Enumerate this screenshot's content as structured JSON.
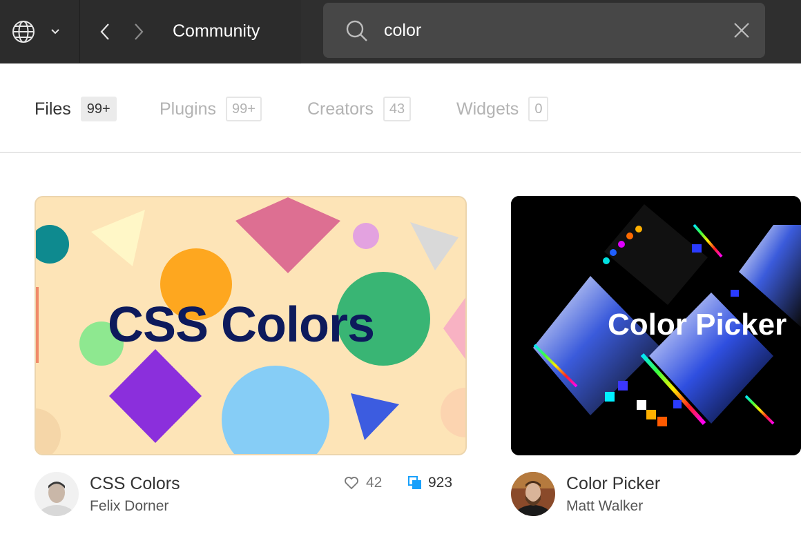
{
  "topbar": {
    "globe_icon": "globe-icon",
    "dropdown_icon": "chevron-down-icon",
    "back_icon": "chevron-left-icon",
    "forward_icon": "chevron-right-icon",
    "breadcrumb": "Community"
  },
  "search": {
    "value": "color",
    "search_icon": "search-icon",
    "clear_icon": "close-icon"
  },
  "tabs": [
    {
      "label": "Files",
      "count": "99+",
      "active": true
    },
    {
      "label": "Plugins",
      "count": "99+",
      "active": false
    },
    {
      "label": "Creators",
      "count": "43",
      "active": false
    },
    {
      "label": "Widgets",
      "count": "0",
      "active": false
    }
  ],
  "cards": [
    {
      "thumbnail_text": "CSS Colors",
      "title": "CSS Colors",
      "author": "Felix Dorner",
      "likes": "42",
      "duplicates": "923"
    },
    {
      "thumbnail_text": "Color Picker",
      "title": "Color Picker",
      "author": "Matt Walker"
    }
  ],
  "colors": {
    "topbar_bg": "#2c2c2c",
    "search_bg": "#474747",
    "accent_blue": "#18a0fb",
    "css_title": "#0d1a5c",
    "css_thumb_bg": "#fde4b7"
  }
}
